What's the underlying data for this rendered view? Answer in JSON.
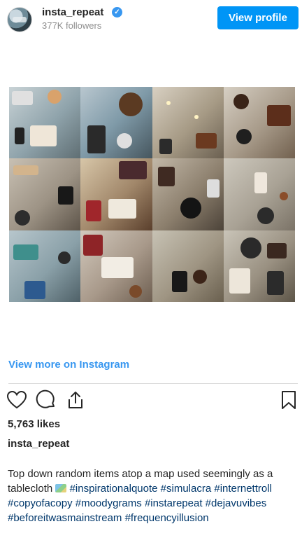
{
  "header": {
    "username": "insta_repeat",
    "followers": "377K followers",
    "view_profile_label": "View profile"
  },
  "post": {
    "view_more_label": "View more on Instagram",
    "likes": "5,763 likes",
    "caption_username": "insta_repeat",
    "caption_text": "Top down random items atop a map used seemingly as a tablecloth",
    "hashtags": "#inspirationalquote #simulacra #internettroll #copyofacopy #moodygrams #instarepeat #dejavuvibes #beforeitwasmainstream #frequencyillusion"
  },
  "icons": {
    "verified": "verified-badge-icon",
    "like": "heart-icon",
    "comment": "comment-icon",
    "share": "share-icon",
    "save": "bookmark-icon",
    "caption_emoji": "world-map-emoji"
  },
  "colors": {
    "accent": "#0095f6",
    "link": "#3897f0",
    "hashtag": "#00376b",
    "text": "#262626",
    "muted": "#8e8e8e"
  }
}
